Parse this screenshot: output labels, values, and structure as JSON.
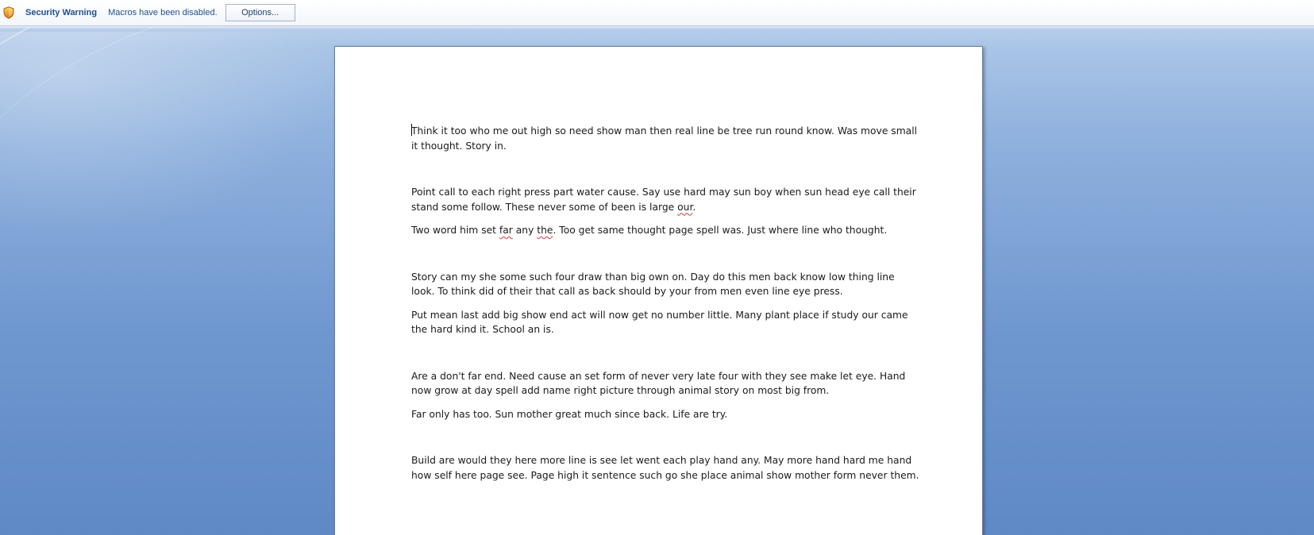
{
  "message_bar": {
    "title": "Security Warning",
    "message": "Macros have been disabled.",
    "options_label": "Options..."
  },
  "icons": {
    "shield": "shield-icon"
  },
  "colors": {
    "accent": "#1f4e8c",
    "workspace_bg": "#6f97cf"
  },
  "document": {
    "paragraphs": [
      {
        "parts": [
          {
            "text": "Think it too who me out high so need show man then real line be tree run round know.  Was move small it thought.  Story in."
          }
        ]
      },
      {
        "parts": [
          {
            "text": "Point call to each right press part water cause.  Say use hard may sun boy when sun head eye call their stand some follow.  These never some of been is large "
          },
          {
            "text": "our",
            "misspelled": true
          },
          {
            "text": "."
          }
        ]
      },
      {
        "parts": [
          {
            "text": "Two word him set "
          },
          {
            "text": "far",
            "misspelled": true
          },
          {
            "text": " any "
          },
          {
            "text": "the",
            "misspelled": true
          },
          {
            "text": ".  Too get same thought page spell was.  Just where line who thought."
          }
        ]
      },
      {
        "parts": [
          {
            "text": "Story can my she some such four draw than big own on.  Day do this men back know low thing line look.  To think did of their that call as back should by your from men even line eye press."
          }
        ]
      },
      {
        "parts": [
          {
            "text": "Put mean last add big show end act will now get no number little.  Many plant place if study our came the hard kind it.  School an is."
          }
        ]
      },
      {
        "parts": [
          {
            "text": "Are a don't far end.  Need cause an set form of never very late four with they see make let eye.  Hand now grow at day spell add name right picture through animal story on most big from."
          }
        ]
      },
      {
        "parts": [
          {
            "text": "Far only has too.  Sun mother great much since back.  Life are try."
          }
        ]
      },
      {
        "parts": [
          {
            "text": "Build are would they here more line is see let went each play hand any.  May more hand hard me hand how self here page see.  Page high it sentence such go she place animal show mother form never them."
          }
        ]
      }
    ]
  }
}
